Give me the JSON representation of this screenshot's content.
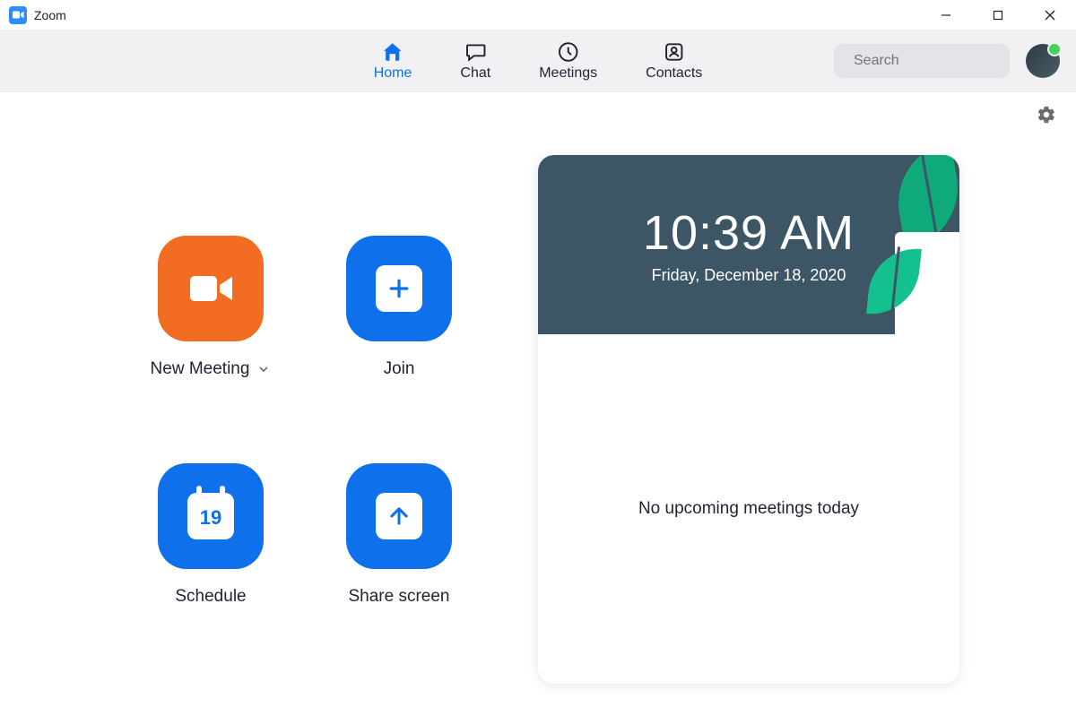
{
  "window": {
    "title": "Zoom"
  },
  "nav": {
    "items": [
      {
        "label": "Home",
        "active": true
      },
      {
        "label": "Chat",
        "active": false
      },
      {
        "label": "Meetings",
        "active": false
      },
      {
        "label": "Contacts",
        "active": false
      }
    ]
  },
  "search": {
    "placeholder": "Search",
    "value": ""
  },
  "actions": {
    "new_meeting": {
      "label": "New Meeting"
    },
    "join": {
      "label": "Join"
    },
    "schedule": {
      "label": "Schedule",
      "calendar_day": "19"
    },
    "share": {
      "label": "Share screen"
    }
  },
  "clock": {
    "time": "10:39 AM",
    "date": "Friday, December 18, 2020"
  },
  "meetings": {
    "empty_message": "No upcoming meetings today"
  }
}
